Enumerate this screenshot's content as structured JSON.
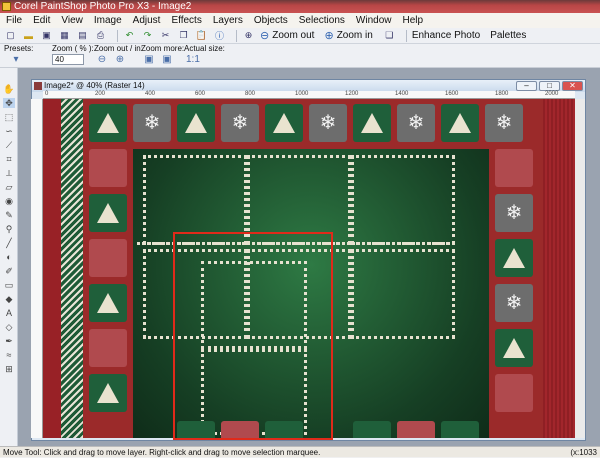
{
  "window": {
    "title": "Corel PaintShop Photo Pro X3 - Image2"
  },
  "menu": [
    "File",
    "Edit",
    "View",
    "Image",
    "Adjust",
    "Effects",
    "Layers",
    "Objects",
    "Selections",
    "Window",
    "Help"
  ],
  "toolbar": {
    "zoom_out": "Zoom out",
    "zoom_in": "Zoom in",
    "enhance": "Enhance Photo",
    "palettes": "Palettes"
  },
  "options": {
    "presets": "Presets:",
    "zoom_label": "Zoom ( % ):",
    "zoom_value": "40",
    "zoom_outin": "Zoom out / in:",
    "zoom_more": "Zoom more:",
    "actual_size": "Actual size:"
  },
  "image_window": {
    "title": "Image2* @ 40% (Raster 14)"
  },
  "ruler": {
    "top": [
      "0",
      "200",
      "400",
      "600",
      "800",
      "1000",
      "1200",
      "1400",
      "1600",
      "1800",
      "2000"
    ]
  },
  "status": {
    "text": "Move Tool: Click and drag to move layer. Right-click and drag to move selection marquee.",
    "coords": "(x:1033"
  },
  "colors": {
    "selection": "#e02a1a",
    "board": "#1f5f3a",
    "tile_red": "#b04a4e",
    "tile_gray": "#6d6d6d"
  }
}
